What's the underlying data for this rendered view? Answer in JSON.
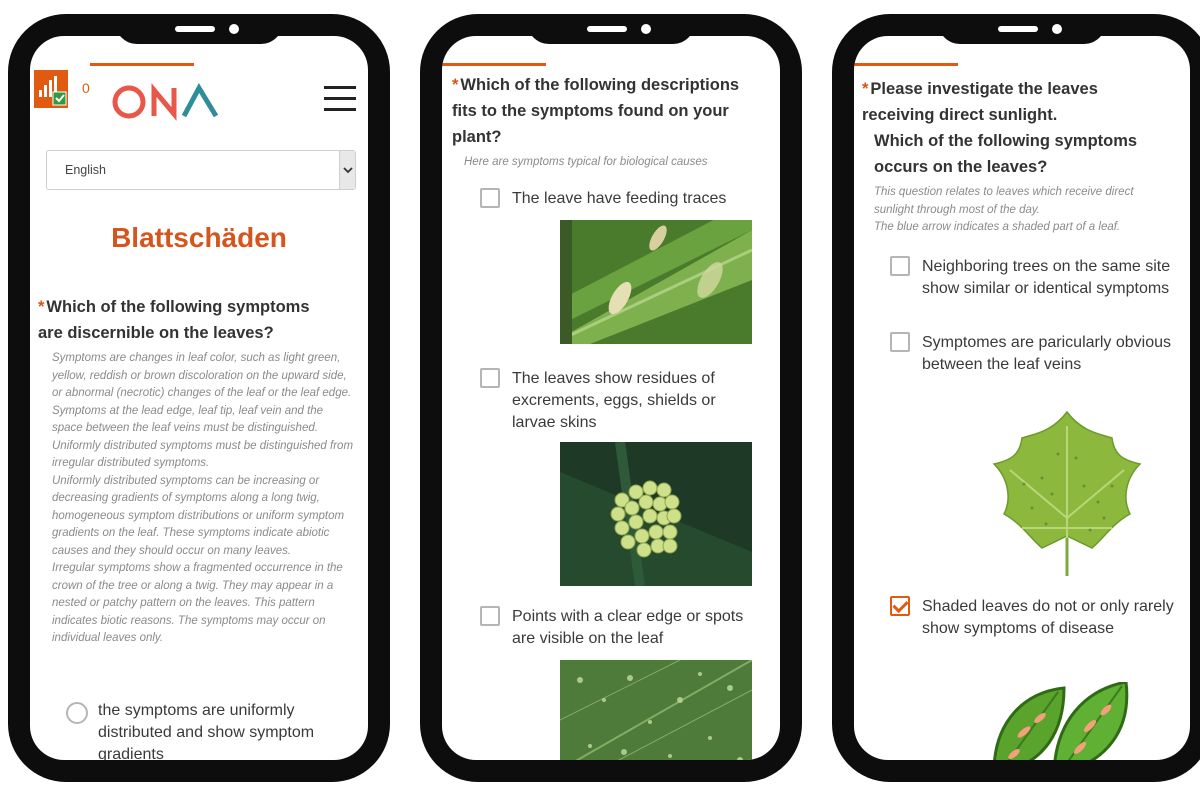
{
  "colors": {
    "accent": "#e05a12",
    "title": "#d4561c",
    "text": "#333333",
    "hint": "#8a8a8a",
    "frame": "#0d0d0d"
  },
  "phone1": {
    "progress_count": "0",
    "logo_text": "ONA",
    "language_select": {
      "selected": "English"
    },
    "page_title": "Blattschäden",
    "question": {
      "required_mark": "*",
      "title": "Which of the following symptoms are discernible on the leaves?",
      "hint": "Symptoms are changes in leaf color, such as light green, yellow, reddish or brown discoloration on the upward side, or abnormal (necrotic) changes of the leaf or the leaf edge. Symptoms at the lead edge, leaf tip, leaf vein and the space between the leaf veins must be distinguished. Uniformly distributed symptoms must be distinguished from irregular distributed symptoms.\nUniformly distributed symptoms can be increasing or decreasing gradients of symptoms along a long twig, homogeneous symptom distributions or uniform symptom gradients on the leaf. These symptoms indicate abiotic causes and they should occur on many leaves.\nIrregular symptoms show a fragmented occurrence in the crown of the tree or along a twig. They may appear in a nested or patchy pattern on the leaves. This pattern indicates biotic reasons. The symptoms may occur on individual leaves only.",
      "options": [
        {
          "label": "the symptoms are uniformly distributed and show symptom gradients",
          "selected": false
        }
      ]
    }
  },
  "phone2": {
    "question": {
      "required_mark": "*",
      "title": "Which of the following descriptions fits to the symptoms found on your plant?",
      "hint": "Here are symptoms typical for biological causes",
      "options": [
        {
          "label": "The leave have feeding traces",
          "checked": false,
          "image": "leaf-feeding-traces-photo"
        },
        {
          "label": "The leaves show residues of excrements, eggs, shields or larvae skins",
          "checked": false,
          "image": "insect-eggs-photo"
        },
        {
          "label": "Points with a clear edge or spots are visible on the leaf",
          "checked": false,
          "image": "leaf-spots-photo"
        }
      ]
    }
  },
  "phone3": {
    "question": {
      "required_mark": "*",
      "title_line1": "Please investigate the leaves receiving direct sunlight.",
      "title_line2": "Which of the following symptoms occurs on the leaves?",
      "hint": "This question relates to leaves which receive direct sunlight through most of the day.\nThe blue arrow indicates a shaded part of a leaf.",
      "options": [
        {
          "label": "Neighboring trees on the same site show similar or identical symptoms",
          "checked": false
        },
        {
          "label": "Symptomes are paricularly obvious between the leaf veins",
          "checked": false,
          "image": "tulip-tree-leaf-illustration"
        },
        {
          "label": "Shaded leaves do not or only rarely show symptoms of disease",
          "checked": true,
          "image": "spotted-leaves-illustration"
        }
      ]
    }
  }
}
